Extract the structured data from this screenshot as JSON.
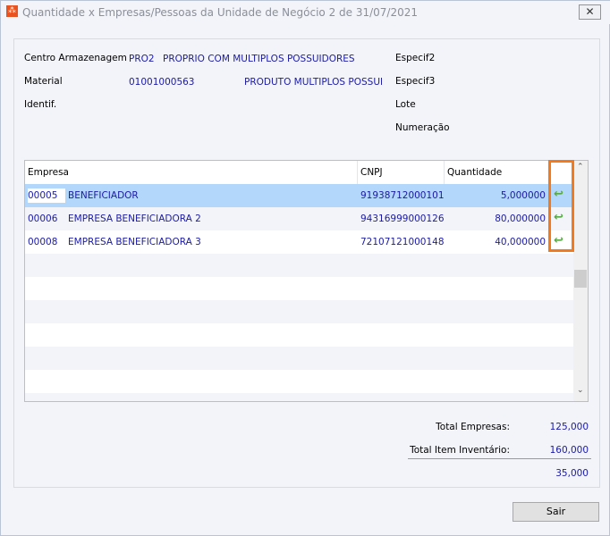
{
  "window": {
    "title": "Quantidade x Empresas/Pessoas da Unidade de Negócio 2 de 31/07/2021",
    "close": "✕"
  },
  "info": {
    "centro_label": "Centro Armazenagem",
    "centro_code": "PRO2",
    "centro_desc": "PROPRIO COM MULTIPLOS POSSUIDORES",
    "material_label": "Material",
    "material_code": "01001000563",
    "material_desc": "PRODUTO MULTIPLOS POSSUID",
    "identif_label": "Identif.",
    "especif2_label": "Especif2",
    "especif3_label": "Especif3",
    "lote_label": "Lote",
    "numeracao_label": "Numeração"
  },
  "grid": {
    "headers": [
      "Empresa",
      "CNPJ",
      "Quantidade"
    ],
    "rows": [
      {
        "code": "00005",
        "name": "BENEFICIADOR",
        "cnpj": "91938712000101",
        "qty": "5,000000"
      },
      {
        "code": "00006",
        "name": "EMPRESA BENEFICIADORA 2",
        "cnpj": "94316999000126",
        "qty": "80,000000"
      },
      {
        "code": "00008",
        "name": "EMPRESA BENEFICIADORA 3",
        "cnpj": "72107121000148",
        "qty": "40,000000"
      }
    ]
  },
  "totals": {
    "empresas_label": "Total Empresas:",
    "empresas": "125,000",
    "inventario_label": "Total Item Inventário:",
    "inventario": "160,000",
    "diff": "35,000"
  },
  "buttons": {
    "sair": "Sair"
  }
}
